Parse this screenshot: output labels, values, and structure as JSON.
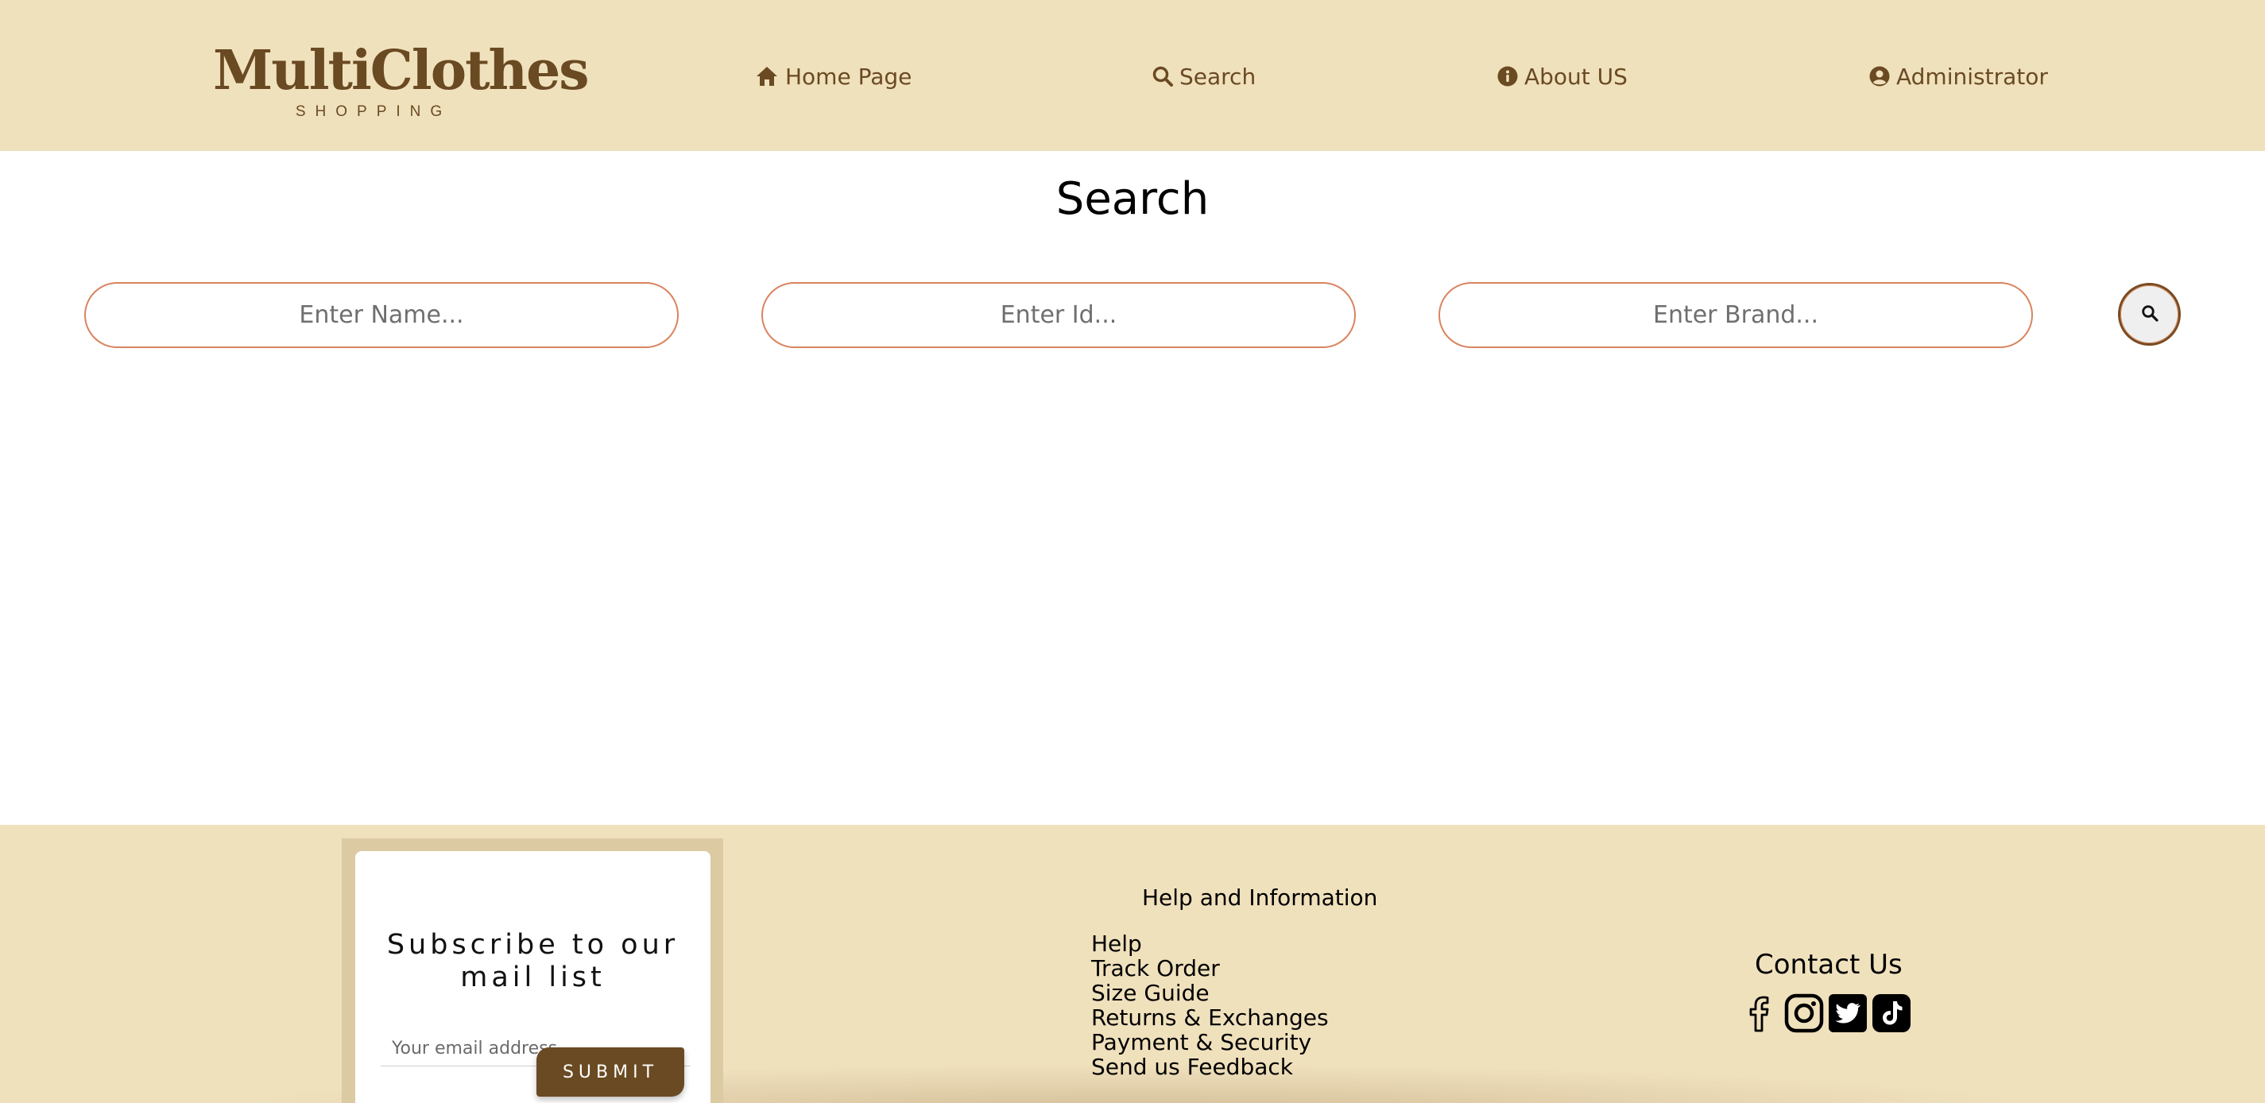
{
  "header": {
    "logo_main": "MultiClothes",
    "logo_sub": "SHOPPING",
    "nav": [
      {
        "label": "Home Page",
        "icon": "home-icon"
      },
      {
        "label": "Search",
        "icon": "search-icon"
      },
      {
        "label": "About US",
        "icon": "info-icon"
      },
      {
        "label": "Administrator",
        "icon": "user-circle-icon"
      }
    ]
  },
  "main": {
    "title": "Search",
    "name_placeholder": "Enter Name...",
    "id_placeholder": "Enter Id...",
    "brand_placeholder": "Enter Brand...",
    "search_button_icon": "search-icon"
  },
  "footer": {
    "subscribe": {
      "title": "Subscribe to our mail list",
      "email_placeholder": "Your email address",
      "submit_label": "SUBMIT"
    },
    "help": {
      "title": "Help and Information",
      "links": [
        "Help",
        "Track Order",
        "Size Guide",
        "Returns & Exchanges",
        "Payment & Security",
        "Send us Feedback"
      ]
    },
    "contact": {
      "title": "Contact Us",
      "socials": [
        "facebook-icon",
        "instagram-icon",
        "twitter-icon",
        "tiktok-icon"
      ]
    }
  },
  "colors": {
    "header_bg": "#f0e1bd",
    "brand_brown": "#6a4a22",
    "input_border": "#d9845f"
  }
}
